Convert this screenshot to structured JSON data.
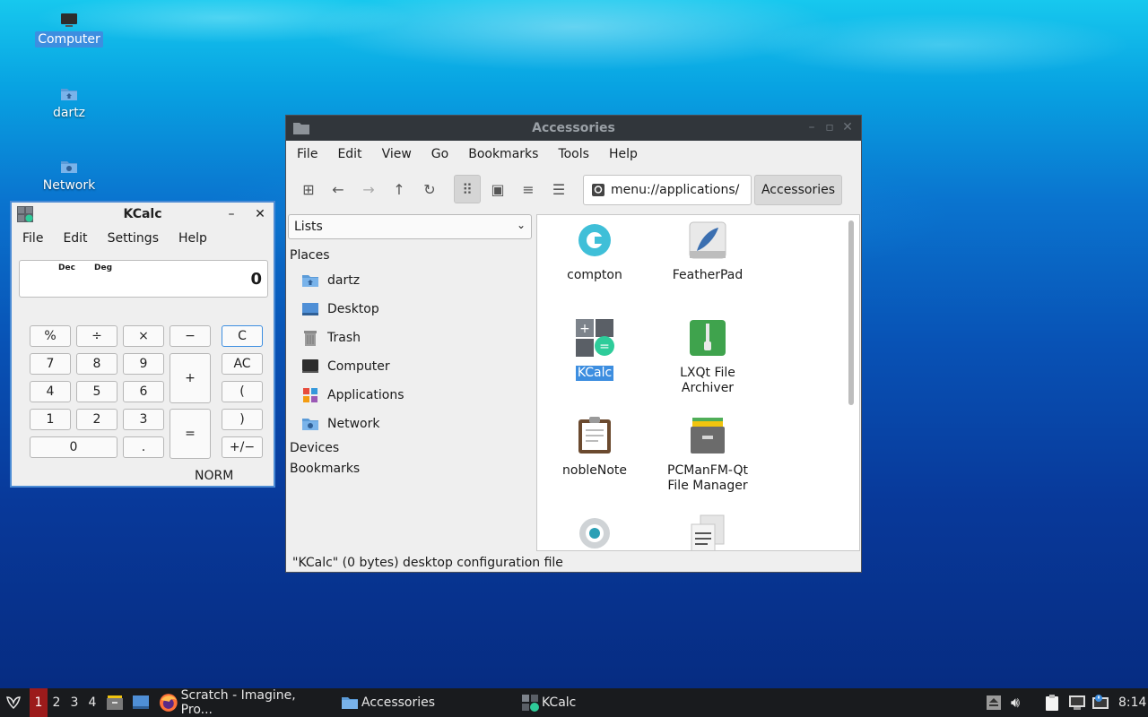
{
  "desktop": {
    "icons": [
      {
        "label": "Computer"
      },
      {
        "label": "dartz"
      },
      {
        "label": "Network"
      }
    ]
  },
  "kcalc": {
    "title": "KCalc",
    "menu": [
      "File",
      "Edit",
      "Settings",
      "Help"
    ],
    "display": {
      "base": "Dec",
      "angle": "Deg",
      "value": "0"
    },
    "buttons": [
      "%",
      "÷",
      "×",
      "−",
      "C",
      "7",
      "8",
      "9",
      "+",
      "AC",
      "4",
      "5",
      "6",
      "(",
      "1",
      "2",
      "3",
      "=",
      ")",
      "0",
      ".",
      "+/−"
    ],
    "status": "NORM"
  },
  "filemanager": {
    "title": "Accessories",
    "menu": [
      "File",
      "Edit",
      "View",
      "Go",
      "Bookmarks",
      "Tools",
      "Help"
    ],
    "address": "menu://applications/",
    "breadcrumb": "Accessories",
    "side_mode": "Lists",
    "places_header": "Places",
    "places": [
      {
        "label": "dartz"
      },
      {
        "label": "Desktop"
      },
      {
        "label": "Trash"
      },
      {
        "label": "Computer"
      },
      {
        "label": "Applications"
      },
      {
        "label": "Network"
      }
    ],
    "devices_header": "Devices",
    "bookmarks_header": "Bookmarks",
    "items": [
      {
        "name": "compton"
      },
      {
        "name": "FeatherPad"
      },
      {
        "name": "KCalc"
      },
      {
        "name": "LXQt File\nArchiver"
      },
      {
        "name": "nobleNote"
      },
      {
        "name": "PCManFM-Qt\nFile Manager"
      }
    ],
    "status": "\"KCalc\" (0 bytes) desktop configuration file"
  },
  "taskbar": {
    "desktops": [
      "1",
      "2",
      "3",
      "4"
    ],
    "tasks": [
      {
        "label": "Scratch - Imagine, Pro..."
      },
      {
        "label": "Accessories"
      },
      {
        "label": "KCalc"
      }
    ],
    "clock": "8:14"
  },
  "colors": {
    "selection": "#3d8ee0",
    "taskbar": "#191b1e",
    "titlebar_dark": "#31363b"
  }
}
